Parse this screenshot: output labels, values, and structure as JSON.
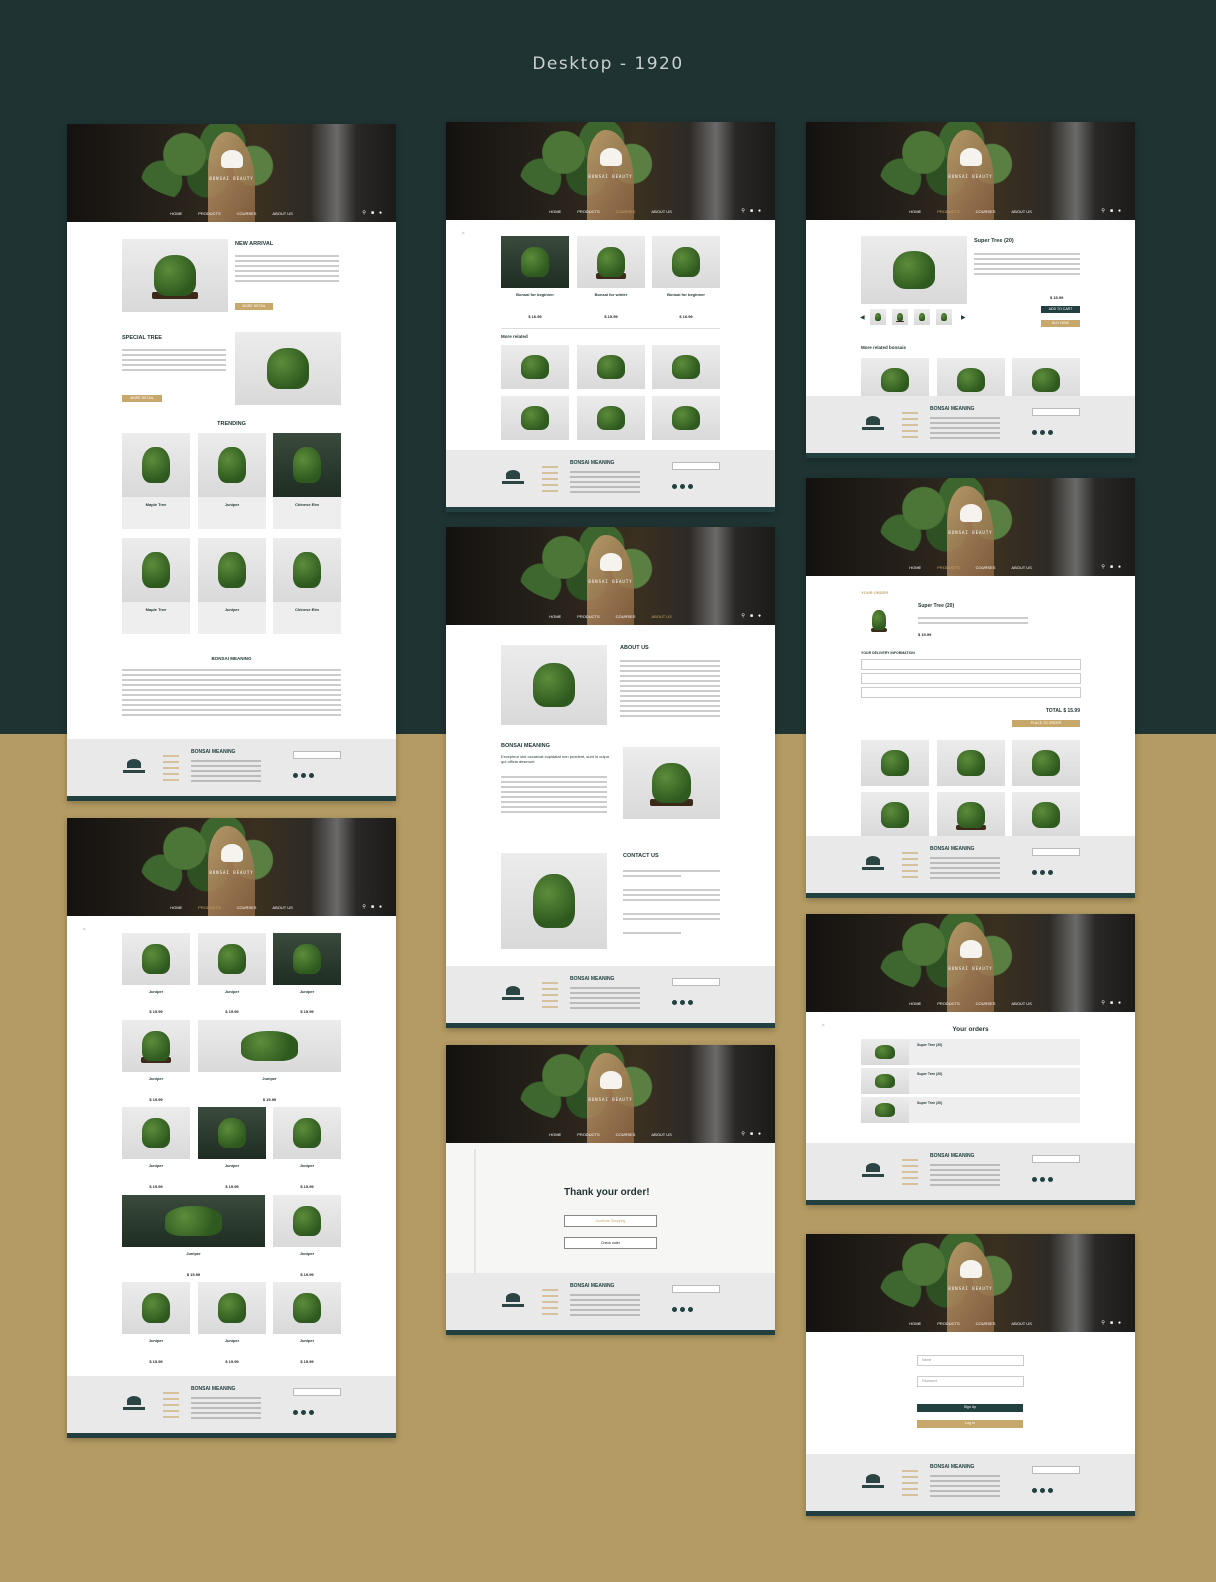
{
  "title": "Desktop - 1920",
  "brand": "BONSAI BEAUTY",
  "nav": [
    "HOME",
    "PRODUCTS",
    "COURSES",
    "ABOUT US"
  ],
  "footer": {
    "heading": "BONSAI MEANING"
  },
  "home": {
    "new_arrival": "NEW ARRIVAL",
    "more_details": "MORE DETAIL",
    "special_tree": "SPECIAL TREE",
    "more_details_2": "MORE DETAIL",
    "trending": "TRENDING",
    "cards": [
      "Maple Tree",
      "Juniper",
      "Chinese Elm",
      "Maple Tree",
      "Juniper",
      "Chinese Elm"
    ],
    "meaning": "BONSAI MEANING"
  },
  "category": {
    "cards": [
      "Bonsai for beginner",
      "Bonsai for winter",
      "Bonsai for beginner"
    ],
    "prices": [
      "$ 16.99",
      "$ 15.99",
      "$ 16.99"
    ],
    "more_related": "More related"
  },
  "about": {
    "about_us": "ABOUT US",
    "bonsai_meaning": "BONSAI MEANING",
    "intro": "Excepteur sint occaecat cupidatat non proident, sunt in culpa qui officia deserunt",
    "contact_us": "CONTACT US"
  },
  "thankyou": {
    "title": "Thank your order!",
    "btn1": "Continue Shopping",
    "btn2": "Check order"
  },
  "products": {
    "rows": [
      {
        "names": [
          "Juniper",
          "Juniper",
          "Juniper"
        ],
        "prices": [
          "$ 15.99",
          "$ 19.99",
          "$ 15.99"
        ]
      },
      {
        "names": [
          "Juniper",
          "Juniper"
        ],
        "prices": [
          "$ 19.99",
          "$ 19.99"
        ]
      },
      {
        "names": [
          "Juniper",
          "Juniper",
          "Juniper"
        ],
        "prices": [
          "$ 15.99",
          "$ 19.99",
          "$ 15.99"
        ]
      },
      {
        "names": [
          "Juniper",
          "Juniper"
        ],
        "prices": [
          "$ 15.99",
          "$ 19.99"
        ]
      },
      {
        "names": [
          "Juniper",
          "Juniper",
          "Juniper"
        ],
        "prices": [
          "$ 15.99",
          "$ 19.99",
          "$ 15.99"
        ]
      }
    ]
  },
  "detail": {
    "name": "Super Tree (20)",
    "price": "$ 15.99",
    "add_to_cart": "ADD TO CART",
    "buy_now": "BUY NOW",
    "more_related": "More related bonsais"
  },
  "cart": {
    "your_order": "YOUR ORDER",
    "name": "Super Tree (20)",
    "price": "$ 15.99",
    "delivery": "YOUR DELIVERY INFORMATION",
    "total": "TOTAL $ 15.99",
    "place_order": "PLACE TO ORDER"
  },
  "orders": {
    "title": "Your orders",
    "items": [
      "Super Tree (20)",
      "Super Tree (20)",
      "Super Tree (20)"
    ]
  },
  "login": {
    "name_ph": "Name",
    "pass_ph": "Password",
    "signup": "Sign Up",
    "login": "Log in"
  }
}
